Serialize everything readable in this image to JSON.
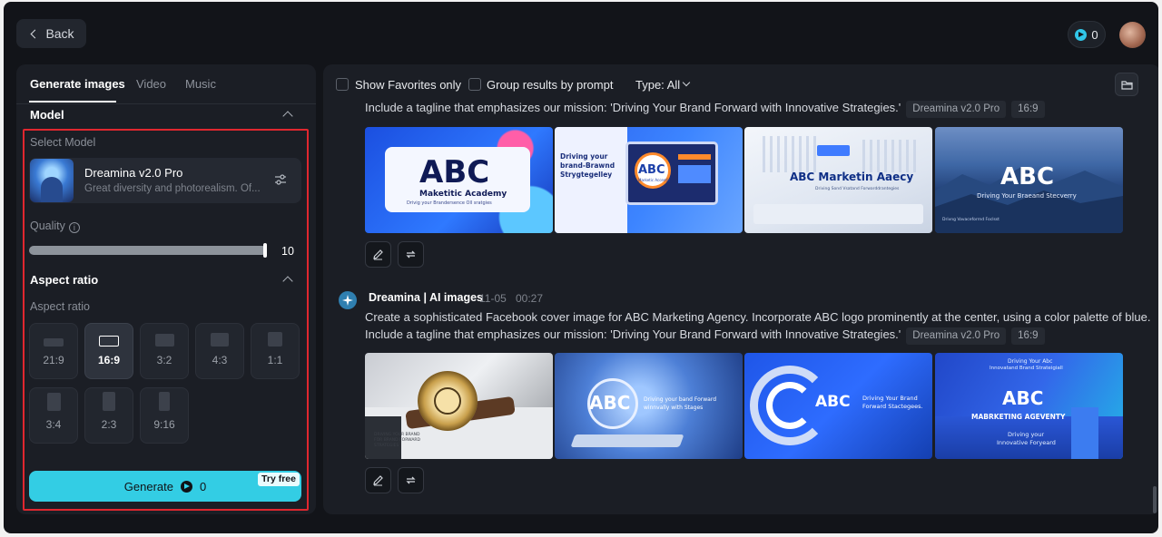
{
  "topbar": {
    "back_label": "Back",
    "credits": "0"
  },
  "tabs": [
    {
      "label": "Generate images",
      "active": true
    },
    {
      "label": "Video",
      "active": false
    },
    {
      "label": "Music",
      "active": false
    }
  ],
  "model_section": {
    "title": "Model",
    "select_label": "Select Model",
    "model_name": "Dreamina v2.0 Pro",
    "model_description": "Great diversity and photorealism. Of..."
  },
  "quality": {
    "label": "Quality",
    "value": "10",
    "level_fraction": 1.0
  },
  "aspect_section": {
    "title": "Aspect ratio",
    "sub_label": "Aspect ratio",
    "options": [
      {
        "label": "21:9",
        "selected": false
      },
      {
        "label": "16:9",
        "selected": true
      },
      {
        "label": "3:2",
        "selected": false
      },
      {
        "label": "4:3",
        "selected": false
      },
      {
        "label": "1:1",
        "selected": false
      },
      {
        "label": "3:4",
        "selected": false
      },
      {
        "label": "2:3",
        "selected": false
      },
      {
        "label": "9:16",
        "selected": false
      }
    ]
  },
  "generate": {
    "label": "Generate",
    "cost": "0",
    "badge": "Try free"
  },
  "filters": {
    "favorites": "Show Favorites only",
    "group": "Group results by prompt",
    "type": "Type: All"
  },
  "results": [
    {
      "prompt_line2": "Include a tagline that emphasizes our mission: 'Driving Your Brand Forward with Innovative Strategies.'",
      "model_tag": "Dreamina v2.0 Pro",
      "ratio_tag": "16:9",
      "images": [
        {
          "lines": [
            "ABC",
            "Maketitic Academy",
            "Drivig your Brandersence Oll sratgies"
          ]
        },
        {
          "lines": [
            "Driving your",
            "brand-Brawnd",
            "Strygtegelley",
            "ABC",
            "Marketic Accentic"
          ]
        },
        {
          "lines": [
            "ABC Marketin Aaecy",
            "Driving Sond Vsatand Forwarddrantegies"
          ]
        },
        {
          "lines": [
            "ABC",
            "Driving Your Braeand Stecverry",
            "Drivng Vavaceforrnd Foclsst"
          ]
        }
      ]
    },
    {
      "author": "Dreamina | AI images",
      "date": "11-05",
      "time": "00:27",
      "prompt_line1": "Create a sophisticated Facebook cover image for ABC Marketing Agency. Incorporate ABC logo prominently at the center, using a color palette of blue.",
      "prompt_line2": "Include a tagline that emphasizes our mission: 'Driving Your Brand Forward with Innovative Strategies.'",
      "model_tag": "Dreamina v2.0 Pro",
      "ratio_tag": "16:9",
      "images": [
        {
          "lines": [
            "DRIVING YOUR BRAND",
            "FOR BRAND FORWARD",
            "STRATEGIES"
          ]
        },
        {
          "lines": [
            "ABC",
            "Driving your band Forward",
            "winnvally with Stages"
          ]
        },
        {
          "lines": [
            "ABC",
            "Driving Your Brand",
            "Forward Stactegees."
          ]
        },
        {
          "lines": [
            "Driving Your Abc",
            "Innovatand Brand Strateigiall",
            "ABC",
            "MABRKETING AGEVENTY",
            "Driving your",
            "Innovative Foryeard"
          ]
        }
      ]
    }
  ],
  "colors": {
    "accent": "#33cde4",
    "highlight_border": "#e0272f",
    "panel": "#1b1e25",
    "background": "#121419"
  }
}
